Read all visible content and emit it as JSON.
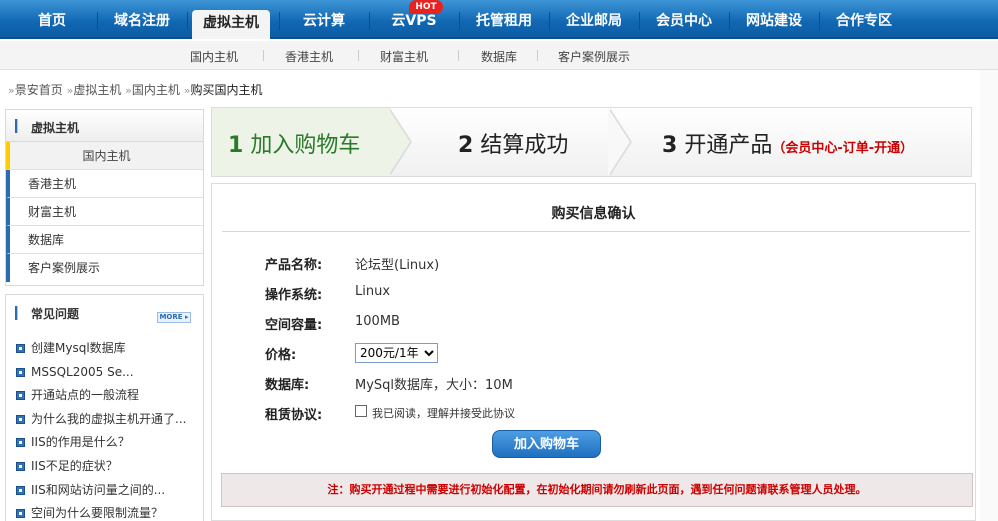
{
  "topnav": {
    "items": [
      "首页",
      "域名注册",
      "虚拟主机",
      "云计算",
      "云VPS",
      "托管租用",
      "企业邮局",
      "会员中心",
      "网站建设",
      "合作专区"
    ],
    "active_index": 2,
    "hot_badge": "HOT"
  },
  "subnav": {
    "items": [
      "国内主机",
      "香港主机",
      "财富主机",
      "数据库",
      "客户案例展示"
    ]
  },
  "breadcrumb": {
    "items": [
      "景安首页",
      "虚拟主机",
      "国内主机"
    ],
    "current": "购买国内主机"
  },
  "sidebar": {
    "hosting_title": "虚拟主机",
    "hosting_items": [
      "国内主机",
      "香港主机",
      "财富主机",
      "数据库",
      "客户案例展示"
    ],
    "faq_title": "常见问题",
    "more_label": "MORE ▸",
    "faq_items": [
      "创建Mysql数据库",
      "MSSQL2005 Se...",
      "开通站点的一般流程",
      "为什么我的虚拟主机开通了...",
      "IIS的作用是什么？",
      "IIS不足的症状？",
      "IIS和网站访问量之间的...",
      "空间为什么要限制流量？"
    ]
  },
  "steps": {
    "step1_num": "1",
    "step1_label": "加入购物车",
    "step2_num": "2",
    "step2_label": "结算成功",
    "step3_num": "3",
    "step3_label": "开通产品",
    "step3_note": "（会员中心-订单-开通）"
  },
  "panel": {
    "title": "购买信息确认",
    "product_label": "产品名称:",
    "product_value": "论坛型(Linux)",
    "os_label": "操作系统:",
    "os_value": "Linux",
    "space_label": "空间容量:",
    "space_value": "100MB",
    "price_label": "价格:",
    "price_selected": "200元/1年",
    "db_label": "数据库:",
    "db_value": "MySql数据库，大小：10M",
    "agreement_label": "租赁协议:",
    "agreement_text": "我已阅读，理解并接受此协议",
    "button_label": "加入购物车",
    "notice": "注：购买开通过程中需要进行初始化配置，在初始化期间请勿刷新此页面，遇到任何问题请联系管理人员处理。"
  },
  "colors": {
    "nav_blue": "#1167b2",
    "step_active": "#2a7a2a",
    "notice_red": "#cc0000"
  }
}
